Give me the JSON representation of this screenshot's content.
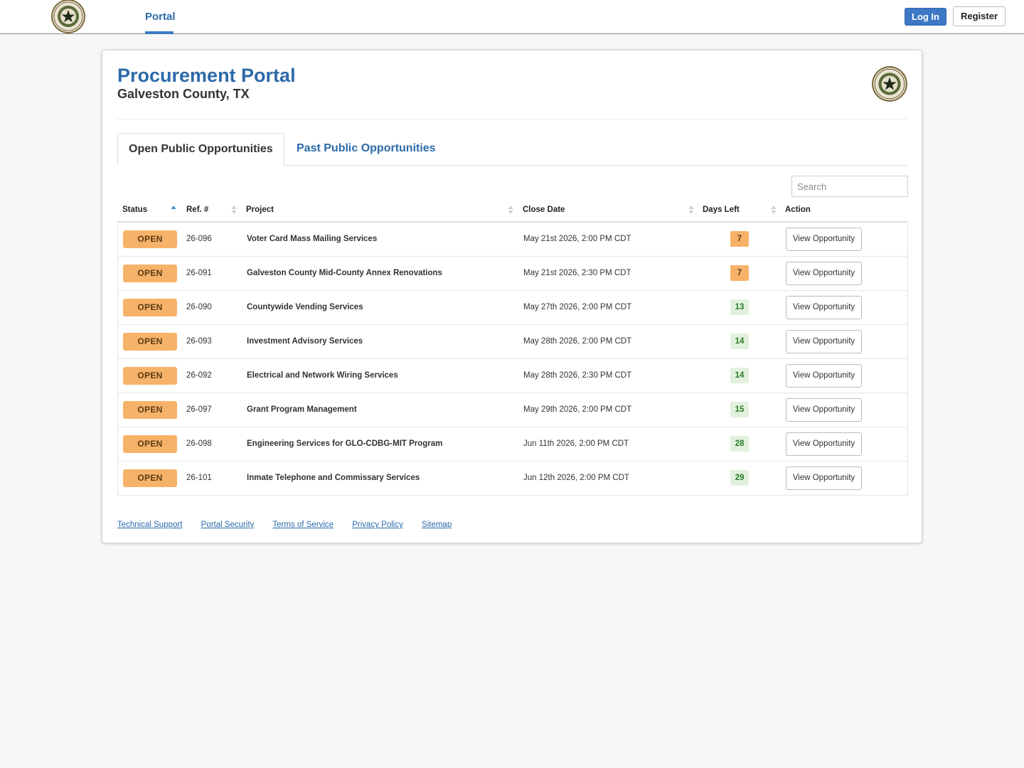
{
  "navbar": {
    "portal_label": "Portal",
    "login_label": "Log In",
    "register_label": "Register"
  },
  "header": {
    "title": "Procurement Portal",
    "subtitle": "Galveston County, TX"
  },
  "tabs": [
    {
      "label": "Open Public Opportunities",
      "active": true
    },
    {
      "label": "Past Public Opportunities",
      "active": false
    }
  ],
  "search": {
    "placeholder": "Search",
    "value": ""
  },
  "table": {
    "columns": [
      "Status",
      "Ref. #",
      "Project",
      "Close Date",
      "Days Left",
      "Action"
    ],
    "rows": [
      {
        "status": "OPEN",
        "ref": "26-096",
        "project": "Voter Card Mass Mailing Services",
        "close_date": "May 21st 2026, 2:00 PM CDT",
        "days_left": "7",
        "action": "View Opportunity"
      },
      {
        "status": "OPEN",
        "ref": "26-091",
        "project": "Galveston County Mid-County Annex Renovations",
        "close_date": "May 21st 2026, 2:30 PM CDT",
        "days_left": "7",
        "action": "View Opportunity"
      },
      {
        "status": "OPEN",
        "ref": "26-090",
        "project": "Countywide Vending Services",
        "close_date": "May 27th 2026, 2:00 PM CDT",
        "days_left": "13",
        "action": "View Opportunity"
      },
      {
        "status": "OPEN",
        "ref": "26-093",
        "project": "Investment Advisory Services",
        "close_date": "May 28th 2026, 2:00 PM CDT",
        "days_left": "14",
        "action": "View Opportunity"
      },
      {
        "status": "OPEN",
        "ref": "26-092",
        "project": "Electrical and Network Wiring Services",
        "close_date": "May 28th 2026, 2:30 PM CDT",
        "days_left": "14",
        "action": "View Opportunity"
      },
      {
        "status": "OPEN",
        "ref": "26-097",
        "project": "Grant Program Management",
        "close_date": "May 29th 2026, 2:00 PM CDT",
        "days_left": "15",
        "action": "View Opportunity"
      },
      {
        "status": "OPEN",
        "ref": "26-098",
        "project": "Engineering Services for GLO-CDBG-MIT Program",
        "close_date": "Jun 11th 2026, 2:00 PM CDT",
        "days_left": "28",
        "action": "View Opportunity"
      },
      {
        "status": "OPEN",
        "ref": "26-101",
        "project": "Inmate Telephone and Commissary Services",
        "close_date": "Jun 12th 2026, 2:00 PM CDT",
        "days_left": "29",
        "action": "View Opportunity"
      }
    ]
  },
  "footer": {
    "links": [
      "Technical Support",
      "Portal Security",
      "Terms of Service",
      "Privacy Policy",
      "Sitemap"
    ]
  },
  "colors": {
    "brand_blue": "#2c6aa8",
    "open_orange": "#f7b26a",
    "days_green_bg": "#e2f1de",
    "days_green_text": "#2a7a2a"
  },
  "icons": {
    "seal": "texas-state-seal-icon",
    "sort": "sort-arrows-icon"
  }
}
